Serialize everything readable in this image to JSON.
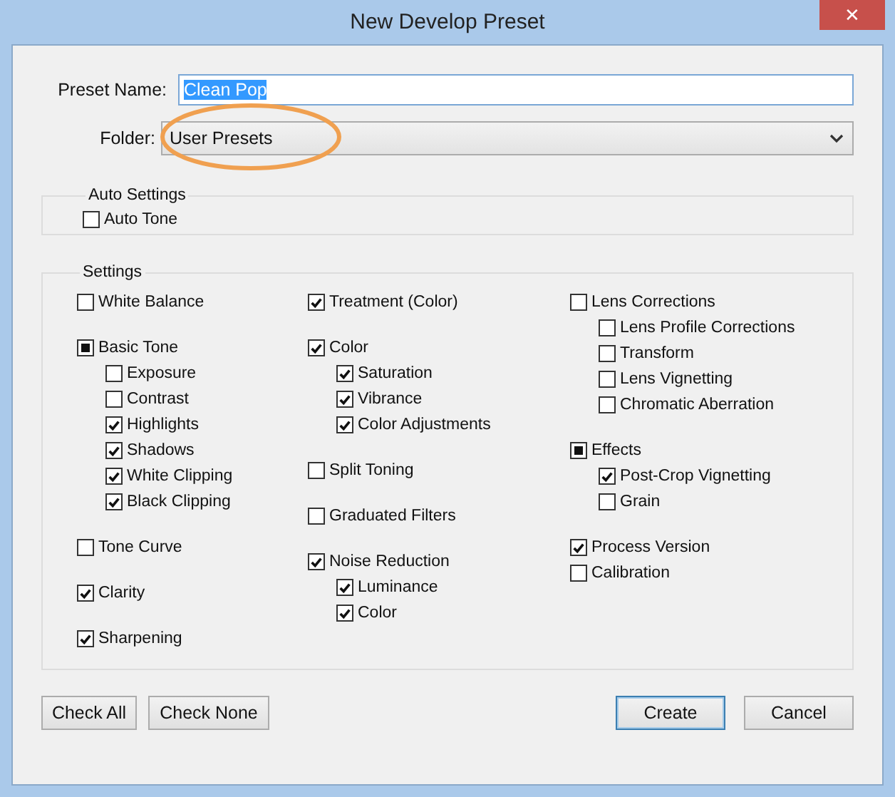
{
  "window": {
    "title": "New Develop Preset",
    "close": "✕"
  },
  "preset_name": {
    "label": "Preset Name:",
    "value": "Clean Pop",
    "text_selected": true
  },
  "folder": {
    "label": "Folder:",
    "value": "User Presets",
    "highlighted": true
  },
  "auto_settings": {
    "title": "Auto Settings",
    "items": [
      {
        "label": "Auto Tone",
        "checked": false,
        "partial": false
      }
    ]
  },
  "settings": {
    "title": "Settings",
    "columns": [
      {
        "groups": [
          {
            "items": [
              {
                "label": "White Balance",
                "checked": false,
                "partial": false
              }
            ]
          },
          {
            "items": [
              {
                "label": "Basic Tone",
                "checked": false,
                "partial": true,
                "children": [
                  {
                    "label": "Exposure",
                    "checked": false,
                    "partial": false
                  },
                  {
                    "label": "Contrast",
                    "checked": false,
                    "partial": false
                  },
                  {
                    "label": "Highlights",
                    "checked": true,
                    "partial": false
                  },
                  {
                    "label": "Shadows",
                    "checked": true,
                    "partial": false
                  },
                  {
                    "label": "White Clipping",
                    "checked": true,
                    "partial": false
                  },
                  {
                    "label": "Black Clipping",
                    "checked": true,
                    "partial": false
                  }
                ]
              }
            ]
          },
          {
            "items": [
              {
                "label": "Tone Curve",
                "checked": false,
                "partial": false
              }
            ]
          },
          {
            "items": [
              {
                "label": "Clarity",
                "checked": true,
                "partial": false
              }
            ]
          },
          {
            "items": [
              {
                "label": "Sharpening",
                "checked": true,
                "partial": false
              }
            ]
          }
        ]
      },
      {
        "groups": [
          {
            "items": [
              {
                "label": "Treatment (Color)",
                "checked": true,
                "partial": false
              }
            ]
          },
          {
            "items": [
              {
                "label": "Color",
                "checked": true,
                "partial": false,
                "children": [
                  {
                    "label": "Saturation",
                    "checked": true,
                    "partial": false
                  },
                  {
                    "label": "Vibrance",
                    "checked": true,
                    "partial": false
                  },
                  {
                    "label": "Color Adjustments",
                    "checked": true,
                    "partial": false
                  }
                ]
              }
            ]
          },
          {
            "items": [
              {
                "label": "Split Toning",
                "checked": false,
                "partial": false
              }
            ]
          },
          {
            "items": [
              {
                "label": "Graduated Filters",
                "checked": false,
                "partial": false
              }
            ]
          },
          {
            "items": [
              {
                "label": "Noise Reduction",
                "checked": true,
                "partial": false,
                "children": [
                  {
                    "label": "Luminance",
                    "checked": true,
                    "partial": false
                  },
                  {
                    "label": "Color",
                    "checked": true,
                    "partial": false
                  }
                ]
              }
            ]
          }
        ]
      },
      {
        "groups": [
          {
            "items": [
              {
                "label": "Lens Corrections",
                "checked": false,
                "partial": false,
                "children": [
                  {
                    "label": "Lens Profile Corrections",
                    "checked": false,
                    "partial": false
                  },
                  {
                    "label": "Transform",
                    "checked": false,
                    "partial": false
                  },
                  {
                    "label": "Lens Vignetting",
                    "checked": false,
                    "partial": false
                  },
                  {
                    "label": "Chromatic Aberration",
                    "checked": false,
                    "partial": false
                  }
                ]
              }
            ]
          },
          {
            "items": [
              {
                "label": "Effects",
                "checked": false,
                "partial": true,
                "children": [
                  {
                    "label": "Post-Crop Vignetting",
                    "checked": true,
                    "partial": false
                  },
                  {
                    "label": "Grain",
                    "checked": false,
                    "partial": false
                  }
                ]
              }
            ]
          },
          {
            "items": [
              {
                "label": "Process Version",
                "checked": true,
                "partial": false
              },
              {
                "label": "Calibration",
                "checked": false,
                "partial": false
              }
            ]
          }
        ]
      }
    ]
  },
  "buttons": [
    {
      "label": "Check All",
      "default": false
    },
    {
      "label": "Check None",
      "default": false
    },
    {
      "label": "Create",
      "default": true
    },
    {
      "label": "Cancel",
      "default": false
    }
  ]
}
